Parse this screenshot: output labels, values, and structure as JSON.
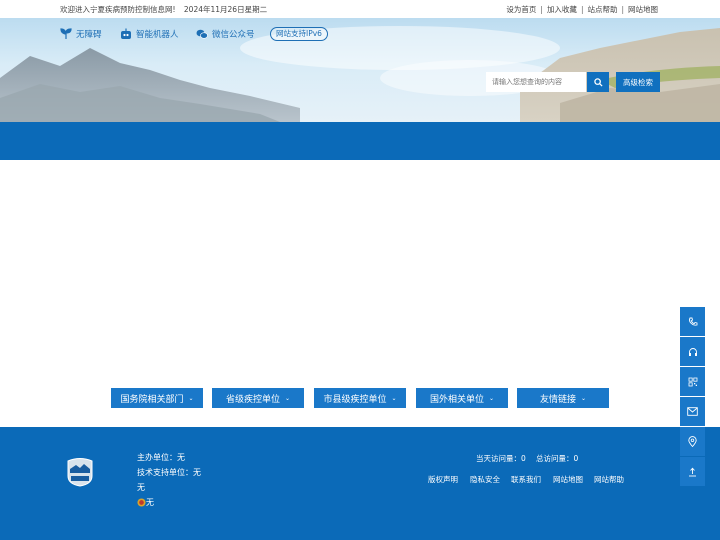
{
  "topbar": {
    "welcome": "欢迎进入宁夏疾病预防控制信息网!",
    "date": "2024年11月26日星期二",
    "links": [
      "设为首页",
      "加入收藏",
      "站点帮助",
      "网站地图"
    ],
    "separator": "|"
  },
  "quick_links": [
    {
      "label": "无障碍",
      "icon": "accessibility-leaf-icon"
    },
    {
      "label": "智能机器人",
      "icon": "robot-icon"
    },
    {
      "label": "微信公众号",
      "icon": "wechat-icon"
    }
  ],
  "ipv6_badge": "网站支持IPv6",
  "search": {
    "placeholder": "请输入您想查询的内容",
    "button_icon": "search-icon",
    "advanced_label": "高级检索"
  },
  "link_dropdowns": [
    {
      "label": "国务院相关部门"
    },
    {
      "label": "省级疾控单位"
    },
    {
      "label": "市县级疾控单位"
    },
    {
      "label": "国外相关单位"
    },
    {
      "label": "友情链接"
    }
  ],
  "footer": {
    "logo_text": "事业单位",
    "host": "主办单位：无",
    "tech_support": "技术支持单位：无",
    "line3": "无",
    "police_record": "无",
    "today_visits": "当天访问量：0",
    "total_visits": "总访问量：0",
    "links": [
      "版权声明",
      "隐私安全",
      "联系我们",
      "网站地图",
      "网站帮助"
    ]
  },
  "side_float": [
    "phone-icon",
    "headset-icon",
    "qrcode-icon",
    "mail-icon",
    "location-icon",
    "back-to-top-icon"
  ],
  "colors": {
    "primary": "#0b6ab8",
    "button": "#1a78c9",
    "link": "#1e6fb5"
  }
}
